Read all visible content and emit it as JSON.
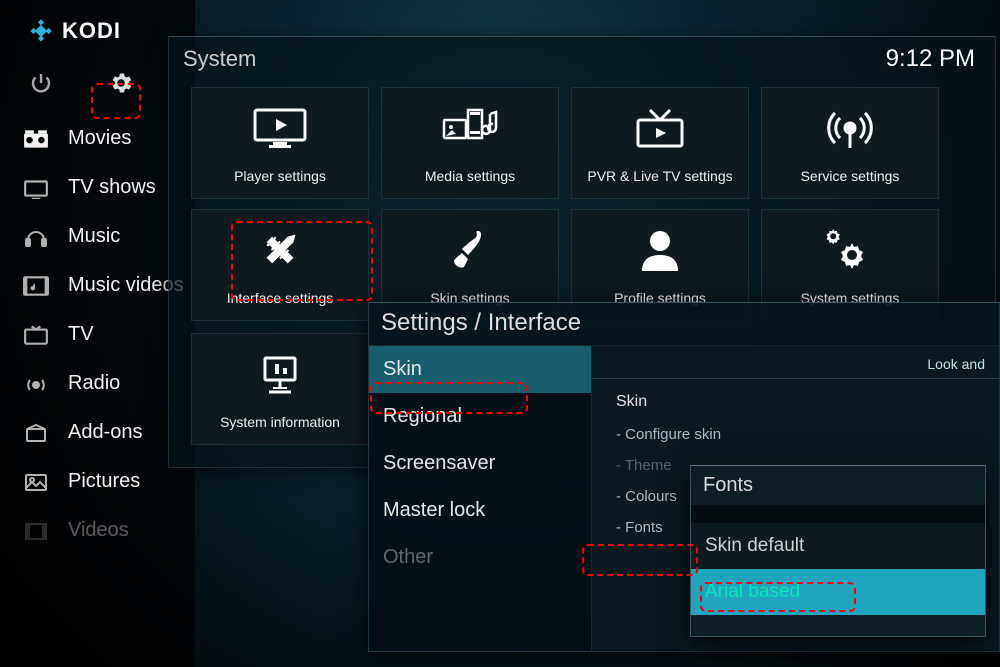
{
  "brand": "KODI",
  "time": "9:12 PM",
  "system_panel": {
    "title": "System"
  },
  "sidebar": {
    "items": [
      {
        "label": "Movies"
      },
      {
        "label": "TV shows"
      },
      {
        "label": "Music"
      },
      {
        "label": "Music videos"
      },
      {
        "label": "TV"
      },
      {
        "label": "Radio"
      },
      {
        "label": "Add-ons"
      },
      {
        "label": "Pictures"
      },
      {
        "label": "Videos"
      }
    ]
  },
  "tiles": {
    "player": "Player settings",
    "media": "Media settings",
    "pvr": "PVR & Live TV settings",
    "service": "Service settings",
    "interface": "Interface settings",
    "skin": "Skin settings",
    "profile": "Profile settings",
    "system": "System settings",
    "sysinfo": "System information"
  },
  "interface_panel": {
    "title": "Settings / Interface",
    "section_label": "Look and",
    "categories": {
      "skin": "Skin",
      "regional": "Regional",
      "screensaver": "Screensaver",
      "masterlock": "Master lock",
      "other": "Other"
    },
    "options": {
      "heading": "Skin",
      "configure": "- Configure skin",
      "theme": "- Theme",
      "colours": "- Colours",
      "fonts": "- Fonts"
    }
  },
  "fonts_popup": {
    "title": "Fonts",
    "default": "Skin default",
    "arial": "Arial based"
  }
}
